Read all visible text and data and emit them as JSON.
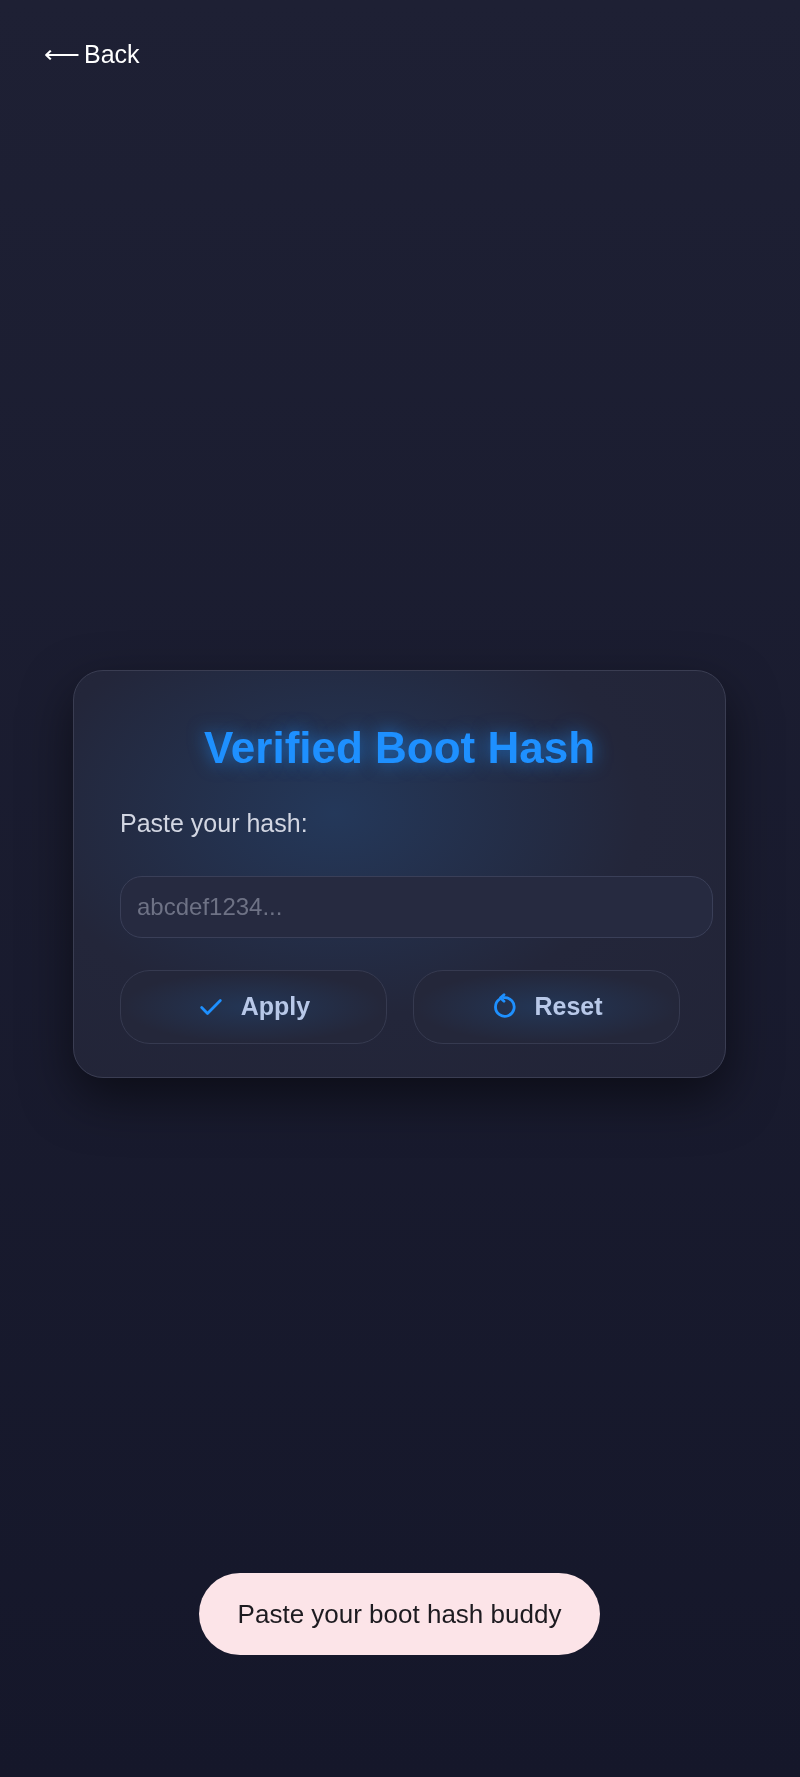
{
  "back": {
    "arrow": "⟵",
    "label": "Back"
  },
  "card": {
    "title": "Verified Boot Hash",
    "label": "Paste your hash:",
    "input": {
      "placeholder": "abcdef1234..."
    },
    "buttons": [
      {
        "kind": "apply",
        "label": "Apply"
      },
      {
        "kind": "reset",
        "label": "Reset"
      }
    ]
  },
  "toast": "Paste your boot hash buddy"
}
